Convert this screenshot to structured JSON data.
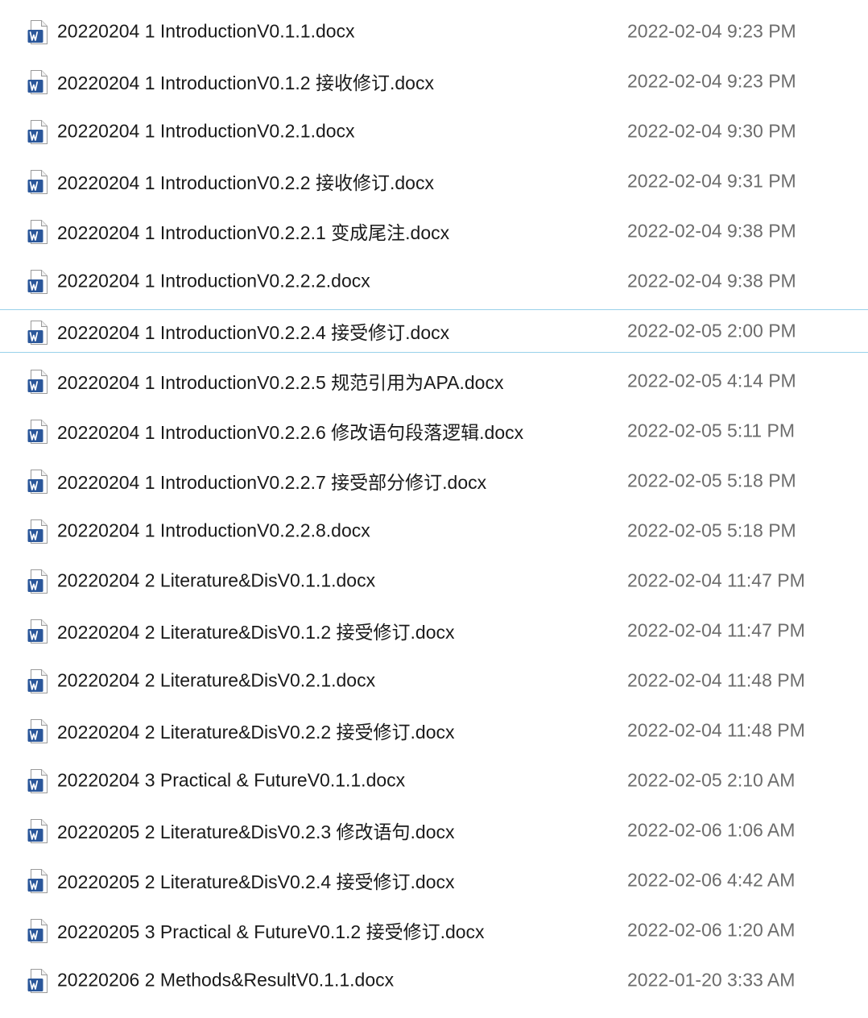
{
  "icon": "word-document-icon",
  "colors": {
    "icon_blue": "#2b579a",
    "row_hover_border": "#99d1ea",
    "name_text": "#1a1a1a",
    "date_text": "#6d6d6d"
  },
  "files": [
    {
      "name": "20220204 1 IntroductionV0.1.1.docx",
      "date": "2022-02-04 9:23 PM",
      "hover": false
    },
    {
      "name": "20220204 1 IntroductionV0.1.2 接收修订.docx",
      "date": "2022-02-04 9:23 PM",
      "hover": false
    },
    {
      "name": "20220204 1 IntroductionV0.2.1.docx",
      "date": "2022-02-04 9:30 PM",
      "hover": false
    },
    {
      "name": "20220204 1 IntroductionV0.2.2 接收修订.docx",
      "date": "2022-02-04 9:31 PM",
      "hover": false
    },
    {
      "name": "20220204 1 IntroductionV0.2.2.1 变成尾注.docx",
      "date": "2022-02-04 9:38 PM",
      "hover": false
    },
    {
      "name": "20220204 1 IntroductionV0.2.2.2.docx",
      "date": "2022-02-04 9:38 PM",
      "hover": false
    },
    {
      "name": "20220204 1 IntroductionV0.2.2.4 接受修订.docx",
      "date": "2022-02-05 2:00 PM",
      "hover": true
    },
    {
      "name": "20220204 1 IntroductionV0.2.2.5 规范引用为APA.docx",
      "date": "2022-02-05 4:14 PM",
      "hover": false
    },
    {
      "name": "20220204 1 IntroductionV0.2.2.6 修改语句段落逻辑.docx",
      "date": "2022-02-05 5:11 PM",
      "hover": false
    },
    {
      "name": "20220204 1 IntroductionV0.2.2.7 接受部分修订.docx",
      "date": "2022-02-05 5:18 PM",
      "hover": false
    },
    {
      "name": "20220204 1 IntroductionV0.2.2.8.docx",
      "date": "2022-02-05 5:18 PM",
      "hover": false
    },
    {
      "name": "20220204 2 Literature&DisV0.1.1.docx",
      "date": "2022-02-04 11:47 PM",
      "hover": false
    },
    {
      "name": "20220204 2 Literature&DisV0.1.2 接受修订.docx",
      "date": "2022-02-04 11:47 PM",
      "hover": false
    },
    {
      "name": "20220204 2 Literature&DisV0.2.1.docx",
      "date": "2022-02-04 11:48 PM",
      "hover": false
    },
    {
      "name": "20220204 2 Literature&DisV0.2.2 接受修订.docx",
      "date": "2022-02-04 11:48 PM",
      "hover": false
    },
    {
      "name": "20220204 3 Practical & FutureV0.1.1.docx",
      "date": "2022-02-05 2:10 AM",
      "hover": false
    },
    {
      "name": "20220205 2 Literature&DisV0.2.3 修改语句.docx",
      "date": "2022-02-06 1:06 AM",
      "hover": false
    },
    {
      "name": "20220205 2 Literature&DisV0.2.4 接受修订.docx",
      "date": "2022-02-06 4:42 AM",
      "hover": false
    },
    {
      "name": "20220205 3 Practical & FutureV0.1.2 接受修订.docx",
      "date": "2022-02-06 1:20 AM",
      "hover": false
    },
    {
      "name": "20220206 2 Methods&ResultV0.1.1.docx",
      "date": "2022-01-20 3:33 AM",
      "hover": false
    }
  ]
}
